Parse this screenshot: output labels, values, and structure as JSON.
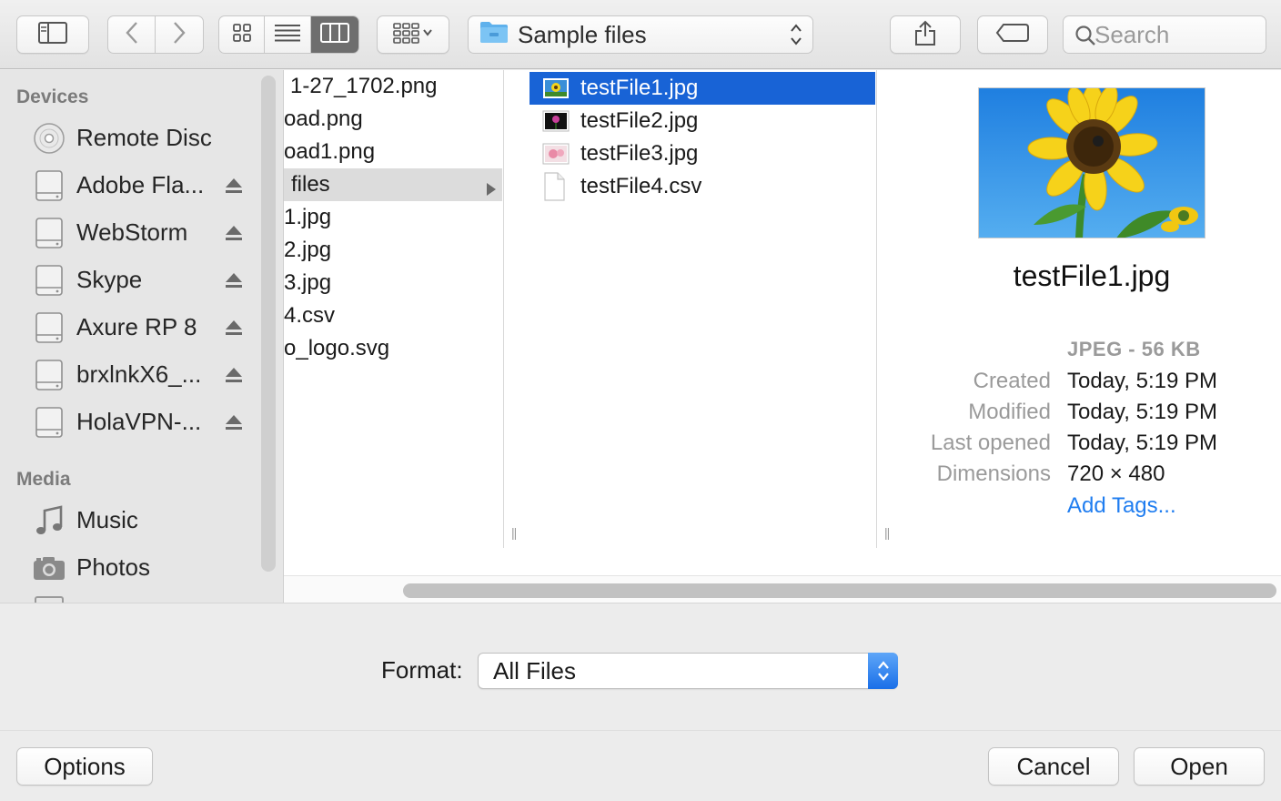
{
  "toolbar": {
    "path_label": "Sample files",
    "search_placeholder": "Search"
  },
  "sidebar": {
    "devices_header": "Devices",
    "devices": [
      {
        "label": "Remote Disc",
        "icon": "disc-icon",
        "ejectable": false
      },
      {
        "label": "Adobe Fla...",
        "icon": "drive-icon",
        "ejectable": true
      },
      {
        "label": "WebStorm",
        "icon": "drive-icon",
        "ejectable": true
      },
      {
        "label": "Skype",
        "icon": "drive-icon",
        "ejectable": true
      },
      {
        "label": "Axure RP 8",
        "icon": "drive-icon",
        "ejectable": true
      },
      {
        "label": "brxlnkX6_...",
        "icon": "drive-icon",
        "ejectable": true
      },
      {
        "label": "HolaVPN-...",
        "icon": "drive-icon",
        "ejectable": true
      }
    ],
    "media_header": "Media",
    "media": [
      {
        "label": "Music",
        "icon": "music-note-icon"
      },
      {
        "label": "Photos",
        "icon": "camera-icon"
      }
    ]
  },
  "column1": {
    "items": [
      {
        "label": "1-27_1702.png",
        "type": "file"
      },
      {
        "label": "oad.png",
        "type": "file"
      },
      {
        "label": "oad1.png",
        "type": "file"
      },
      {
        "label": "files",
        "type": "folder"
      },
      {
        "label": "1.jpg",
        "type": "file"
      },
      {
        "label": "2.jpg",
        "type": "file"
      },
      {
        "label": "3.jpg",
        "type": "file"
      },
      {
        "label": "4.csv",
        "type": "file"
      },
      {
        "label": "o_logo.svg",
        "type": "file"
      }
    ]
  },
  "column2": {
    "items": [
      {
        "label": "testFile1.jpg",
        "selected": true,
        "thumb": "sunflower"
      },
      {
        "label": "testFile2.jpg",
        "selected": false,
        "thumb": "dark-flower"
      },
      {
        "label": "testFile3.jpg",
        "selected": false,
        "thumb": "pink-flower"
      },
      {
        "label": "testFile4.csv",
        "selected": false,
        "thumb": "document"
      }
    ]
  },
  "preview": {
    "filename": "testFile1.jpg",
    "type_size": "JPEG - 56 KB",
    "meta": [
      {
        "key": "Created",
        "value": "Today, 5:19 PM"
      },
      {
        "key": "Modified",
        "value": "Today, 5:19 PM"
      },
      {
        "key": "Last opened",
        "value": "Today, 5:19 PM"
      },
      {
        "key": "Dimensions",
        "value": "720 × 480"
      }
    ],
    "add_tags": "Add Tags..."
  },
  "format": {
    "label": "Format:",
    "selected": "All Files"
  },
  "buttons": {
    "options": "Options",
    "cancel": "Cancel",
    "open": "Open"
  },
  "colors": {
    "selection": "#1863d6",
    "link": "#1f7df0",
    "accent": "#1a6fe8"
  }
}
